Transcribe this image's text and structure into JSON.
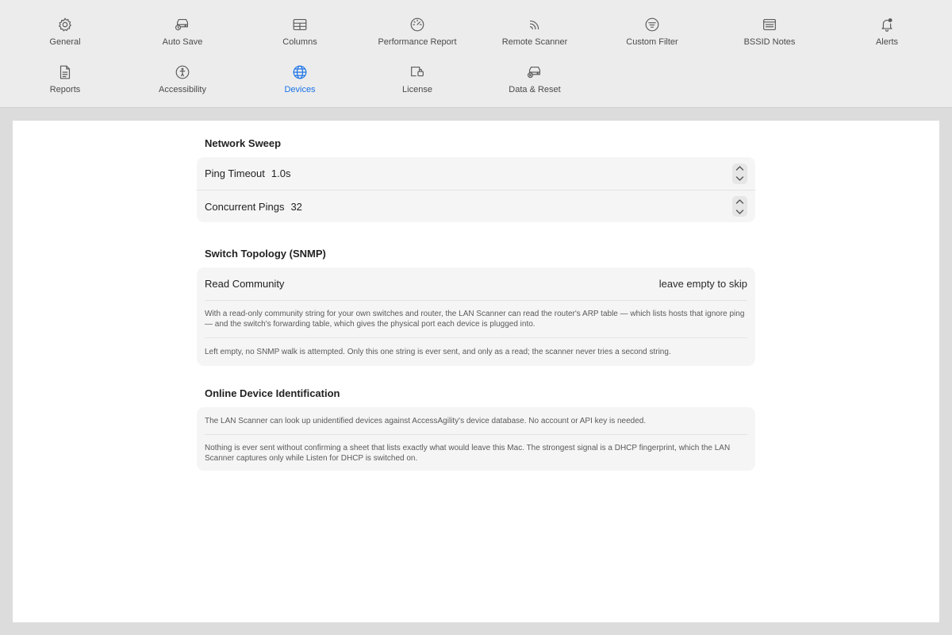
{
  "tabs": [
    {
      "label": "General",
      "icon": "gear-icon"
    },
    {
      "label": "Auto Save",
      "icon": "drive-clock-icon"
    },
    {
      "label": "Columns",
      "icon": "table-icon"
    },
    {
      "label": "Performance Report",
      "icon": "gauge-icon"
    },
    {
      "label": "Remote Scanner",
      "icon": "rss-icon"
    },
    {
      "label": "Custom Filter",
      "icon": "filter-circle-icon"
    },
    {
      "label": "BSSID Notes",
      "icon": "notes-icon"
    },
    {
      "label": "Alerts",
      "icon": "bell-icon"
    },
    {
      "label": "Reports",
      "icon": "document-icon"
    },
    {
      "label": "Accessibility",
      "icon": "accessibility-icon"
    },
    {
      "label": "Devices",
      "icon": "globe-icon"
    },
    {
      "label": "License",
      "icon": "license-icon"
    },
    {
      "label": "Data & Reset",
      "icon": "drive-x-icon"
    }
  ],
  "active_tab": "Devices",
  "accent_color": "#1a73e8",
  "network_sweep": {
    "title": "Network Sweep",
    "ping_timeout_label": "Ping Timeout",
    "ping_timeout_value": "1.0s",
    "concurrent_pings_label": "Concurrent Pings",
    "concurrent_pings_value": "32"
  },
  "snmp": {
    "title": "Switch Topology (SNMP)",
    "read_community_label": "Read Community",
    "read_community_placeholder": "leave empty to skip",
    "note1": "With a read-only community string for your own switches and router, the LAN Scanner can read the router's ARP table — which lists hosts that ignore ping — and the switch's forwarding table, which gives the physical port each device is plugged into.",
    "note2": "Left empty, no SNMP walk is attempted. Only this one string is ever sent, and only as a read; the scanner never tries a second string."
  },
  "identification": {
    "title": "Online Device Identification",
    "note1": "The LAN Scanner can look up unidentified devices against AccessAgility's device database. No account or API key is needed.",
    "note2": "Nothing is ever sent without confirming a sheet that lists exactly what would leave this Mac. The strongest signal is a DHCP fingerprint, which the LAN Scanner captures only while Listen for DHCP is switched on."
  }
}
